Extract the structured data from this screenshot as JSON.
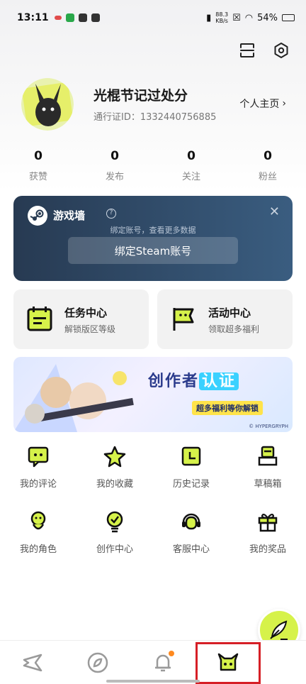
{
  "status_bar": {
    "time": "13:11",
    "speed_top": "88.3",
    "speed_bottom": "KB/s",
    "battery": "54%"
  },
  "profile": {
    "name": "光棍节记过处分",
    "id_label": "通行证ID：1332440756885",
    "homepage_label": "个人主页"
  },
  "stats": [
    {
      "value": "0",
      "label": "获赞"
    },
    {
      "value": "0",
      "label": "发布"
    },
    {
      "value": "0",
      "label": "关注"
    },
    {
      "value": "0",
      "label": "粉丝"
    }
  ],
  "steam_card": {
    "title": "游戏墙",
    "subtitle": "绑定账号，查看更多数据",
    "button_label": "绑定Steam账号"
  },
  "quick_cards": [
    {
      "title": "任务中心",
      "subtitle": "解锁版区等级",
      "icon": "calendar-icon"
    },
    {
      "title": "活动中心",
      "subtitle": "领取超多福利",
      "icon": "flag-icon"
    }
  ],
  "banner": {
    "headline_a": "创作者",
    "headline_b": "认证",
    "subline": "超多福利等你解锁",
    "watermark": "© HYPERGRYPH"
  },
  "menu": [
    {
      "label": "我的评论",
      "icon": "comment-icon"
    },
    {
      "label": "我的收藏",
      "icon": "star-icon"
    },
    {
      "label": "历史记录",
      "icon": "history-icon"
    },
    {
      "label": "草稿箱",
      "icon": "drafts-icon"
    },
    {
      "label": "我的角色",
      "icon": "character-icon"
    },
    {
      "label": "创作中心",
      "icon": "creator-icon"
    },
    {
      "label": "客服中心",
      "icon": "support-icon"
    },
    {
      "label": "我的奖品",
      "icon": "gift-icon"
    }
  ],
  "nav": [
    {
      "name": "home",
      "icon": "home-icon"
    },
    {
      "name": "discover",
      "icon": "compass-icon"
    },
    {
      "name": "notifications",
      "icon": "bell-icon"
    },
    {
      "name": "me",
      "icon": "profile-mascot-icon"
    }
  ],
  "colors": {
    "accent": "#d6f24a",
    "steam_card": "#2f4a69",
    "highlight_box": "#d61f26",
    "badge": "#ff8a1f"
  }
}
